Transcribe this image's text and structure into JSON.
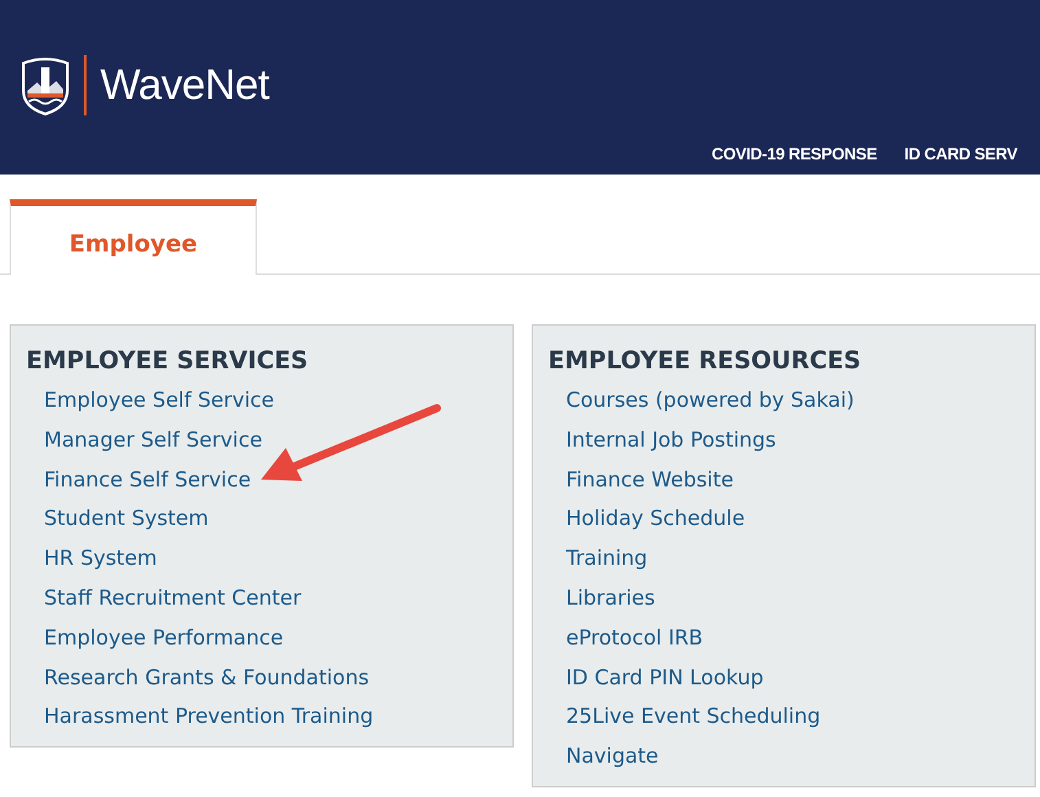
{
  "header": {
    "logo_text": "WaveNet",
    "nav": [
      "COVID-19 RESPONSE",
      "ID CARD SERV"
    ]
  },
  "tabs": [
    {
      "label": "Employee",
      "selected": true
    }
  ],
  "panels": [
    {
      "title": "EMPLOYEE SERVICES",
      "links": [
        "Employee Self Service",
        "Manager Self Service",
        "Finance Self Service",
        "Student System",
        "HR System",
        "Staff Recruitment Center",
        "Employee Performance",
        "Research Grants & Foundations",
        "Harassment Prevention Training"
      ]
    },
    {
      "title": "EMPLOYEE RESOURCES",
      "links": [
        "Courses (powered by Sakai)",
        "Internal Job Postings",
        "Finance Website",
        "Holiday Schedule",
        "Training",
        "Libraries",
        "eProtocol IRB",
        "ID Card PIN Lookup",
        "25Live Event Scheduling",
        "Navigate"
      ]
    }
  ]
}
